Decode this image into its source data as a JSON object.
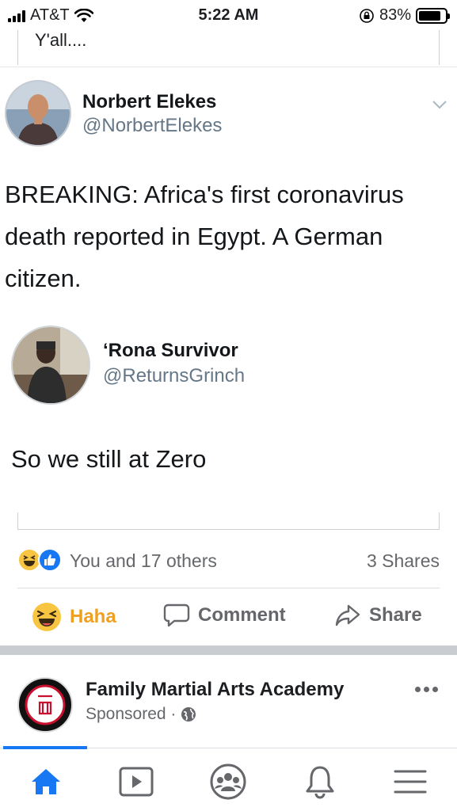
{
  "status_bar": {
    "carrier": "AT&T",
    "time": "5:22 AM",
    "battery_percent": "83%",
    "battery_level": 0.83,
    "icons": [
      "signal-icon",
      "wifi-icon",
      "rotation-lock-icon",
      "battery-icon"
    ]
  },
  "post": {
    "text": "Y'all....",
    "reactions_text": "You and 17 others",
    "shares_text": "3 Shares",
    "reaction_icons": [
      "haha-reaction-icon",
      "like-reaction-icon"
    ]
  },
  "tweets": [
    {
      "name": "Norbert Elekes",
      "handle": "@NorbertElekes",
      "body_lines": [
        "BREAKING: Africa's first coronavirus",
        "death reported in Egypt. A German",
        "citizen."
      ]
    },
    {
      "name": "‘Rona Survivor",
      "handle": "@ReturnsGrinch",
      "body_lines": [
        "So we still at Zero"
      ]
    }
  ],
  "actions": {
    "haha_label": "Haha",
    "comment_label": "Comment",
    "share_label": "Share"
  },
  "next_post": {
    "name": "Family Martial Arts Academy",
    "sponsored": "Sponsored ·"
  },
  "nav": {
    "items": [
      "home-icon",
      "watch-icon",
      "groups-icon",
      "notifications-icon",
      "menu-icon"
    ],
    "active": "home-icon",
    "accent": "#1877f2"
  },
  "colors": {
    "accent": "#1877f2",
    "haha": "#f7c541",
    "muted": "#65676b",
    "twitter_muted": "#657786"
  }
}
